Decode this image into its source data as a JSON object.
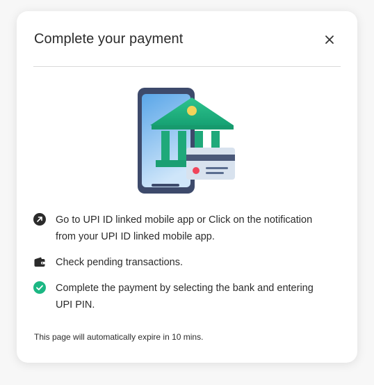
{
  "modal": {
    "title": "Complete your payment",
    "close_icon": "close-icon",
    "illustration": "upi-bank-phone-card-illustration",
    "steps": [
      {
        "icon": "arrow-up-right-circle-icon",
        "text": "Go to UPI ID linked mobile app or Click on the notification from your UPI ID linked mobile app."
      },
      {
        "icon": "wallet-icon",
        "text": "Check pending transactions."
      },
      {
        "icon": "check-circle-icon",
        "text": "Complete the payment by selecting the bank and entering UPI PIN."
      }
    ],
    "expiry_note": "This page will automatically expire in 10 mins."
  },
  "colors": {
    "bank_green": "#1fa97a",
    "phone_frame": "#3d4a6b",
    "success_green": "#1bb783",
    "card_dot": "#f0445a"
  }
}
